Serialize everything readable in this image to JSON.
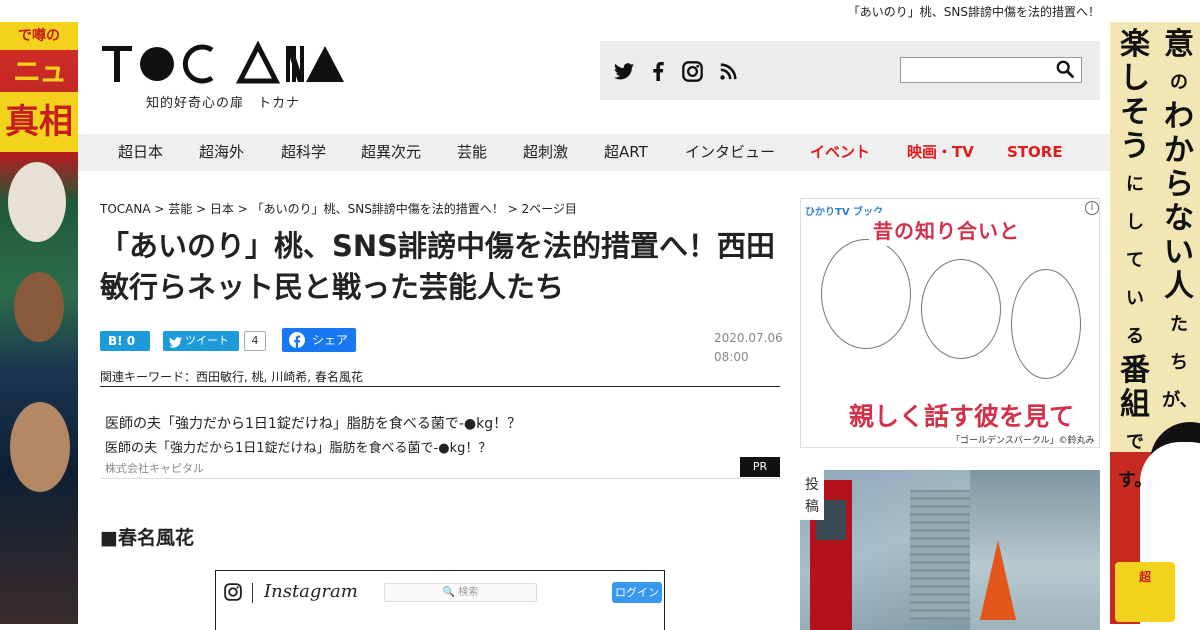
{
  "ticker": "「あいのり」桃、SNS誹謗中傷を法的措置へ！",
  "left_banner": {
    "line1": "で噂の",
    "line2": "ニュース",
    "line3": "真相"
  },
  "right_banner": {
    "col1": "意味のわからない人たちが、",
    "col2": "楽しそうにしている番組です。",
    "badge": "超"
  },
  "header": {
    "logo_text": "TOCANA",
    "tagline": "知的好奇心の扉　トカナ",
    "social": [
      "twitter-icon",
      "facebook-icon",
      "instagram-icon",
      "rss-icon"
    ],
    "search": {
      "placeholder": ""
    }
  },
  "nav": {
    "items": [
      {
        "label": "超日本",
        "accent": false
      },
      {
        "label": "超海外",
        "accent": false
      },
      {
        "label": "超科学",
        "accent": false
      },
      {
        "label": "超異次元",
        "accent": false
      },
      {
        "label": "芸能",
        "accent": false
      },
      {
        "label": "超刺激",
        "accent": false
      },
      {
        "label": "超ART",
        "accent": false
      },
      {
        "label": "インタビュー",
        "accent": false
      },
      {
        "label": "イベント",
        "accent": true
      },
      {
        "label": "映画・TV",
        "accent": true
      },
      {
        "label": "STORE",
        "accent": true
      }
    ],
    "accent_color": "#e01b1b"
  },
  "article": {
    "breadcrumb": "TOCANA > 芸能 > 日本 > 「あいのり」桃、SNS誹謗中傷を法的措置へ！ > 2ページ目",
    "title": "「あいのり」桃、SNS誹謗中傷を法的措置へ！西田敏行らネット民と戦った芸能人たち",
    "share": {
      "hatena_label": "B! 0",
      "tweet_label": "ツイート",
      "tweet_count": "4",
      "facebook_label": "シェア"
    },
    "date": "2020.07.06",
    "time": "08:00",
    "keywords": "関連キーワード：西田敏行, 桃, 川崎希, 春名風花",
    "pr": {
      "title": "医師の夫「強力だから1日1錠だけね」脂肪を食べる菌で-●kg！？",
      "subtitle": "医師の夫「強力だから1日1錠だけね」脂肪を食べる菌で-●kg！？",
      "company": "株式会社キャピタル",
      "badge": "PR"
    },
    "section_heading": "■春名風花",
    "instagram": {
      "wordmark": "Instagram",
      "search_placeholder": "🔍 検索",
      "login_label": "ログイン"
    }
  },
  "sidebar": {
    "ad": {
      "brand": "ひかりTV ブック",
      "headline": "昔の知り合いと",
      "footline": "親しく話す彼を見て",
      "credit": "「ゴールデンスパークル」©鈴丸みんた／集英社",
      "info": "i"
    },
    "photo_label": "投稿"
  }
}
